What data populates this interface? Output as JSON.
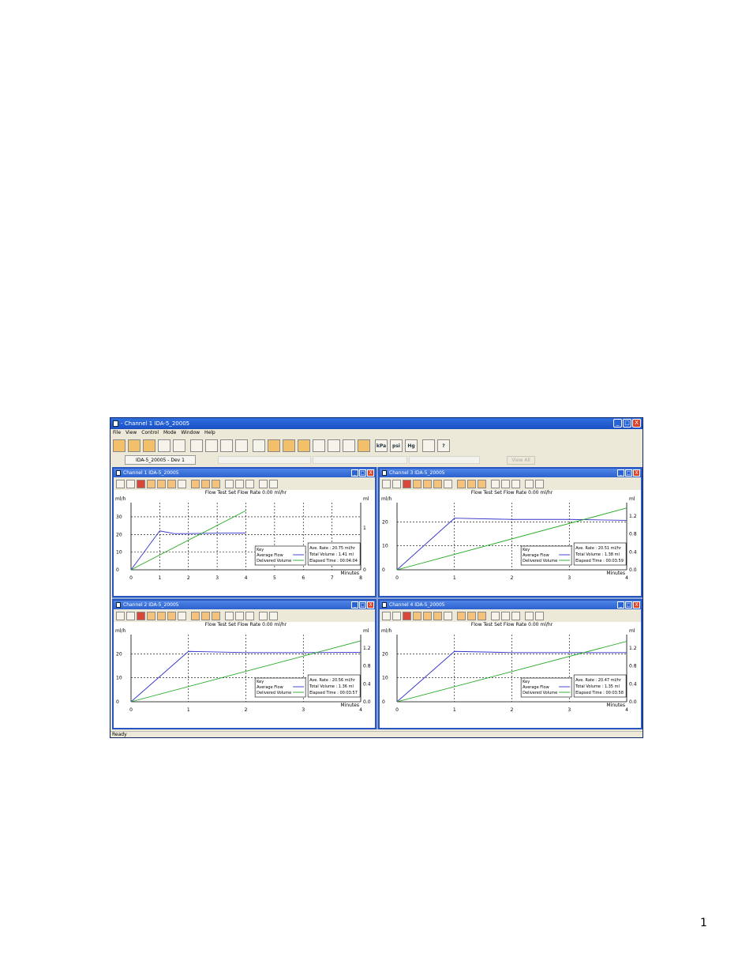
{
  "window": {
    "title": "- Channel 1 IDA-5_20005",
    "controls": [
      "_",
      "□",
      "X"
    ]
  },
  "menu": [
    "File",
    "View",
    "Control",
    "Mode",
    "Window",
    "Help"
  ],
  "toolbar": {
    "labels": {
      "kpa": "kPa",
      "psi": "psi",
      "hg": "Hg"
    }
  },
  "device_tab": {
    "label": "IDA-5_20005 - Dev 1"
  },
  "view_all_label": "View All",
  "statusbar": {
    "text": "Ready"
  },
  "page_number": "1",
  "colors": {
    "average_flow": "#3333cc",
    "delivered_volume": "#22aa22",
    "title_bar": "#2955c2"
  },
  "channels": [
    {
      "title": "Channel 1 IDA-5_20005",
      "header": "Flow Test   Set Flow Rate 0.00 ml/hr",
      "left_unit": "ml/h",
      "right_unit": "ml",
      "x_unit": "Minutes",
      "x_ticks": [
        "0",
        "1",
        "2",
        "3",
        "4",
        "5",
        "6",
        "7",
        "8"
      ],
      "y_ticks": [
        "0",
        "10",
        "20",
        "30"
      ],
      "y2_ticks": [
        "0",
        "1"
      ],
      "legend": {
        "key": "Key",
        "avg": "Average Flow",
        "del": "Delivered Volume"
      },
      "stats": {
        "rate": "Ave. Rate : 20.75 ml/hr",
        "volume": "Total Volume : 1.41 ml",
        "elapsed": "Elapsed Time : 00:04:04"
      }
    },
    {
      "title": "Channel 3 IDA-5_20005",
      "header": "Flow Test   Set Flow Rate 0.00 ml/hr",
      "left_unit": "ml/h",
      "right_unit": "ml",
      "x_unit": "Minutes",
      "x_ticks": [
        "0",
        "1",
        "2",
        "3",
        "4"
      ],
      "y_ticks": [
        "0",
        "10",
        "20"
      ],
      "y2_ticks": [
        "0.0",
        "0.4",
        "0.8",
        "1.2"
      ],
      "legend": {
        "key": "Key",
        "avg": "Average Flow",
        "del": "Delivered Volume"
      },
      "stats": {
        "rate": "Ave. Rate : 20.51 ml/hr",
        "volume": "Total Volume : 1.38 ml",
        "elapsed": "Elapsed Time : 00:03:59"
      }
    },
    {
      "title": "Channel 2 IDA-5_20005",
      "header": "Flow Test   Set Flow Rate 0.00 ml/hr",
      "left_unit": "ml/h",
      "right_unit": "ml",
      "x_unit": "Minutes",
      "x_ticks": [
        "0",
        "1",
        "2",
        "3",
        "4"
      ],
      "y_ticks": [
        "0",
        "10",
        "20"
      ],
      "y2_ticks": [
        "0.0",
        "0.4",
        "0.8",
        "1.2"
      ],
      "legend": {
        "key": "Key",
        "avg": "Average Flow",
        "del": "Delivered Volume"
      },
      "stats": {
        "rate": "Ave. Rate : 20.56 ml/hr",
        "volume": "Total Volume : 1.36 ml",
        "elapsed": "Elapsed Time : 00:03:57"
      }
    },
    {
      "title": "Channel 4 IDA-5_20005",
      "header": "Flow Test   Set Flow Rate 0.00 ml/hr",
      "left_unit": "ml/h",
      "right_unit": "ml",
      "x_unit": "Minutes",
      "x_ticks": [
        "0",
        "1",
        "2",
        "3",
        "4"
      ],
      "y_ticks": [
        "0",
        "10",
        "20"
      ],
      "y2_ticks": [
        "0.0",
        "0.4",
        "0.8",
        "1.2"
      ],
      "legend": {
        "key": "Key",
        "avg": "Average Flow",
        "del": "Delivered Volume"
      },
      "stats": {
        "rate": "Ave. Rate : 20.47 ml/hr",
        "volume": "Total Volume : 1.35 ml",
        "elapsed": "Elapsed Time : 00:03:58"
      }
    }
  ],
  "chart_data": [
    {
      "type": "line",
      "xlim": [
        0,
        8
      ],
      "ylim": [
        0,
        38
      ],
      "y2lim": [
        0,
        1.6
      ],
      "series": [
        {
          "name": "Average Flow",
          "x": [
            0,
            1,
            1.5,
            2,
            3,
            4
          ],
          "y": [
            0,
            22,
            20.5,
            20.5,
            20.7,
            20.8
          ]
        },
        {
          "name": "Delivered Volume",
          "axis": "right",
          "x": [
            0,
            4
          ],
          "y": [
            0,
            1.41
          ]
        }
      ]
    },
    {
      "type": "line",
      "xlim": [
        0,
        4
      ],
      "ylim": [
        0,
        28
      ],
      "y2lim": [
        0,
        1.5
      ],
      "series": [
        {
          "name": "Average Flow",
          "x": [
            0,
            1,
            2,
            3,
            4
          ],
          "y": [
            0,
            21.5,
            21,
            21,
            20.6
          ]
        },
        {
          "name": "Delivered Volume",
          "axis": "right",
          "x": [
            0,
            4
          ],
          "y": [
            0,
            1.38
          ]
        }
      ]
    },
    {
      "type": "line",
      "xlim": [
        0,
        4
      ],
      "ylim": [
        0,
        28
      ],
      "y2lim": [
        0,
        1.5
      ],
      "series": [
        {
          "name": "Average Flow",
          "x": [
            0,
            1,
            2,
            3,
            4
          ],
          "y": [
            0,
            21,
            20.5,
            20.5,
            20.6
          ]
        },
        {
          "name": "Delivered Volume",
          "axis": "right",
          "x": [
            0,
            4
          ],
          "y": [
            0,
            1.36
          ]
        }
      ]
    },
    {
      "type": "line",
      "xlim": [
        0,
        4
      ],
      "ylim": [
        0,
        28
      ],
      "y2lim": [
        0,
        1.5
      ],
      "series": [
        {
          "name": "Average Flow",
          "x": [
            0,
            1,
            2,
            3,
            4
          ],
          "y": [
            0,
            21,
            20.5,
            20.5,
            20.5
          ]
        },
        {
          "name": "Delivered Volume",
          "axis": "right",
          "x": [
            0,
            4
          ],
          "y": [
            0,
            1.35
          ]
        }
      ]
    }
  ]
}
